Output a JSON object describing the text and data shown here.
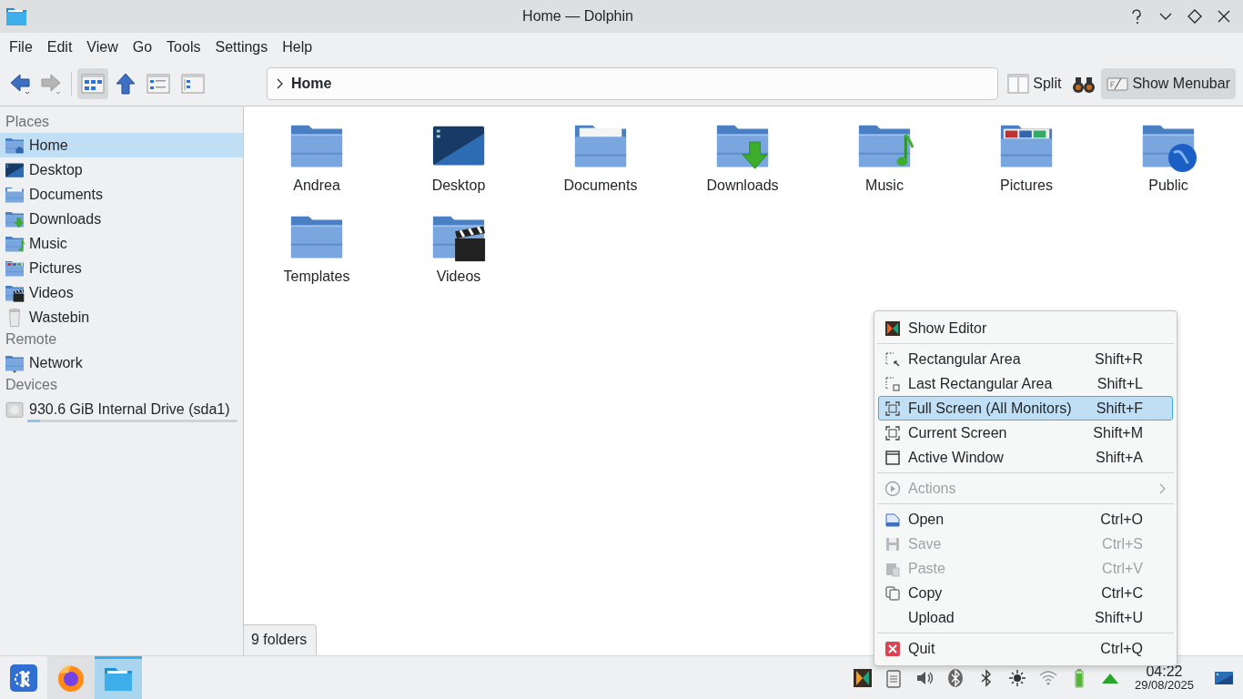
{
  "window": {
    "title": "Home — Dolphin"
  },
  "menubar": [
    {
      "label": "File"
    },
    {
      "label": "Edit"
    },
    {
      "label": "View"
    },
    {
      "label": "Go"
    },
    {
      "label": "Tools"
    },
    {
      "label": "Settings"
    },
    {
      "label": "Help"
    }
  ],
  "toolbar": {
    "view_modes": [
      {
        "kind": "icons",
        "selected": true
      },
      {
        "kind": "details",
        "selected": false
      },
      {
        "kind": "compact",
        "selected": false
      }
    ],
    "breadcrumb": [
      {
        "label": "Home"
      }
    ],
    "split": {
      "label": "Split"
    },
    "show_menubar": {
      "label": "Show Menubar",
      "checked": true
    }
  },
  "places": [
    {
      "heading": "Places",
      "items": [
        {
          "label": "Home",
          "kind": "home",
          "selected": true
        },
        {
          "label": "Desktop",
          "kind": "desktop",
          "selected": false
        },
        {
          "label": "Documents",
          "kind": "documents",
          "selected": false
        },
        {
          "label": "Downloads",
          "kind": "downloads",
          "selected": false
        },
        {
          "label": "Music",
          "kind": "music",
          "selected": false
        },
        {
          "label": "Pictures",
          "kind": "pictures",
          "selected": false
        },
        {
          "label": "Videos",
          "kind": "videos",
          "selected": false
        },
        {
          "label": "Wastebin",
          "kind": "bin",
          "selected": false
        }
      ]
    },
    {
      "heading": "Remote",
      "items": [
        {
          "label": "Network",
          "kind": "network",
          "selected": false
        }
      ]
    },
    {
      "heading": "Devices",
      "items": [
        {
          "label": "930.6 GiB Internal Drive (sda1)",
          "kind": "drive",
          "selected": false,
          "level": 0.06
        }
      ]
    }
  ],
  "files": [
    {
      "name": "Andrea",
      "kind": "folder"
    },
    {
      "name": "Desktop",
      "kind": "desktop"
    },
    {
      "name": "Documents",
      "kind": "documents"
    },
    {
      "name": "Downloads",
      "kind": "downloads"
    },
    {
      "name": "Music",
      "kind": "music"
    },
    {
      "name": "Pictures",
      "kind": "pictures"
    },
    {
      "name": "Public",
      "kind": "public"
    },
    {
      "name": "Templates",
      "kind": "folder"
    },
    {
      "name": "Videos",
      "kind": "videos"
    }
  ],
  "status_bar": {
    "text": "9 folders"
  },
  "menu": {
    "groups": [
      {
        "items": [
          {
            "label": "Show Editor",
            "kind": "editor",
            "disabled": false,
            "selected": false,
            "submenu": false
          }
        ]
      },
      {
        "items": [
          {
            "label": "Rectangular Area",
            "shortcut": "Shift+R",
            "kind": "region",
            "disabled": false,
            "selected": false,
            "submenu": false
          },
          {
            "label": "Last Rectangular Area",
            "shortcut": "Shift+L",
            "kind": "last-region",
            "disabled": false,
            "selected": false,
            "submenu": false
          },
          {
            "label": "Full Screen (All Monitors)",
            "shortcut": "Shift+F",
            "kind": "fullscreen",
            "disabled": false,
            "selected": true,
            "submenu": false
          },
          {
            "label": "Current Screen",
            "shortcut": "Shift+M",
            "kind": "fullscreen",
            "disabled": false,
            "selected": false,
            "submenu": false
          },
          {
            "label": "Active Window",
            "shortcut": "Shift+A",
            "kind": "window",
            "disabled": false,
            "selected": false,
            "submenu": false
          }
        ]
      },
      {
        "items": [
          {
            "label": "Actions",
            "kind": "play",
            "disabled": true,
            "selected": false,
            "submenu": true
          }
        ]
      },
      {
        "items": [
          {
            "label": "Open",
            "shortcut": "Ctrl+O",
            "kind": "open",
            "disabled": false,
            "selected": false,
            "submenu": false
          },
          {
            "label": "Save",
            "shortcut": "Ctrl+S",
            "kind": "save",
            "disabled": true,
            "selected": false,
            "submenu": false
          },
          {
            "label": "Paste",
            "shortcut": "Ctrl+V",
            "kind": "paste",
            "disabled": true,
            "selected": false,
            "submenu": false
          },
          {
            "label": "Copy",
            "shortcut": "Ctrl+C",
            "kind": "copy",
            "disabled": false,
            "selected": false,
            "submenu": false
          },
          {
            "label": "Upload",
            "shortcut": "Shift+U",
            "kind": "none",
            "disabled": false,
            "selected": false,
            "submenu": false
          }
        ]
      },
      {
        "items": [
          {
            "label": "Quit",
            "shortcut": "Ctrl+Q",
            "kind": "quit",
            "disabled": false,
            "selected": false,
            "submenu": false
          }
        ]
      }
    ]
  },
  "taskbar": {
    "apps": [
      {
        "kind": "launcher",
        "selected": false
      },
      {
        "kind": "browser",
        "selected": false
      },
      {
        "kind": "files",
        "selected": true
      }
    ],
    "clock": {
      "time": "04:22",
      "date": "29/08/2025"
    }
  }
}
